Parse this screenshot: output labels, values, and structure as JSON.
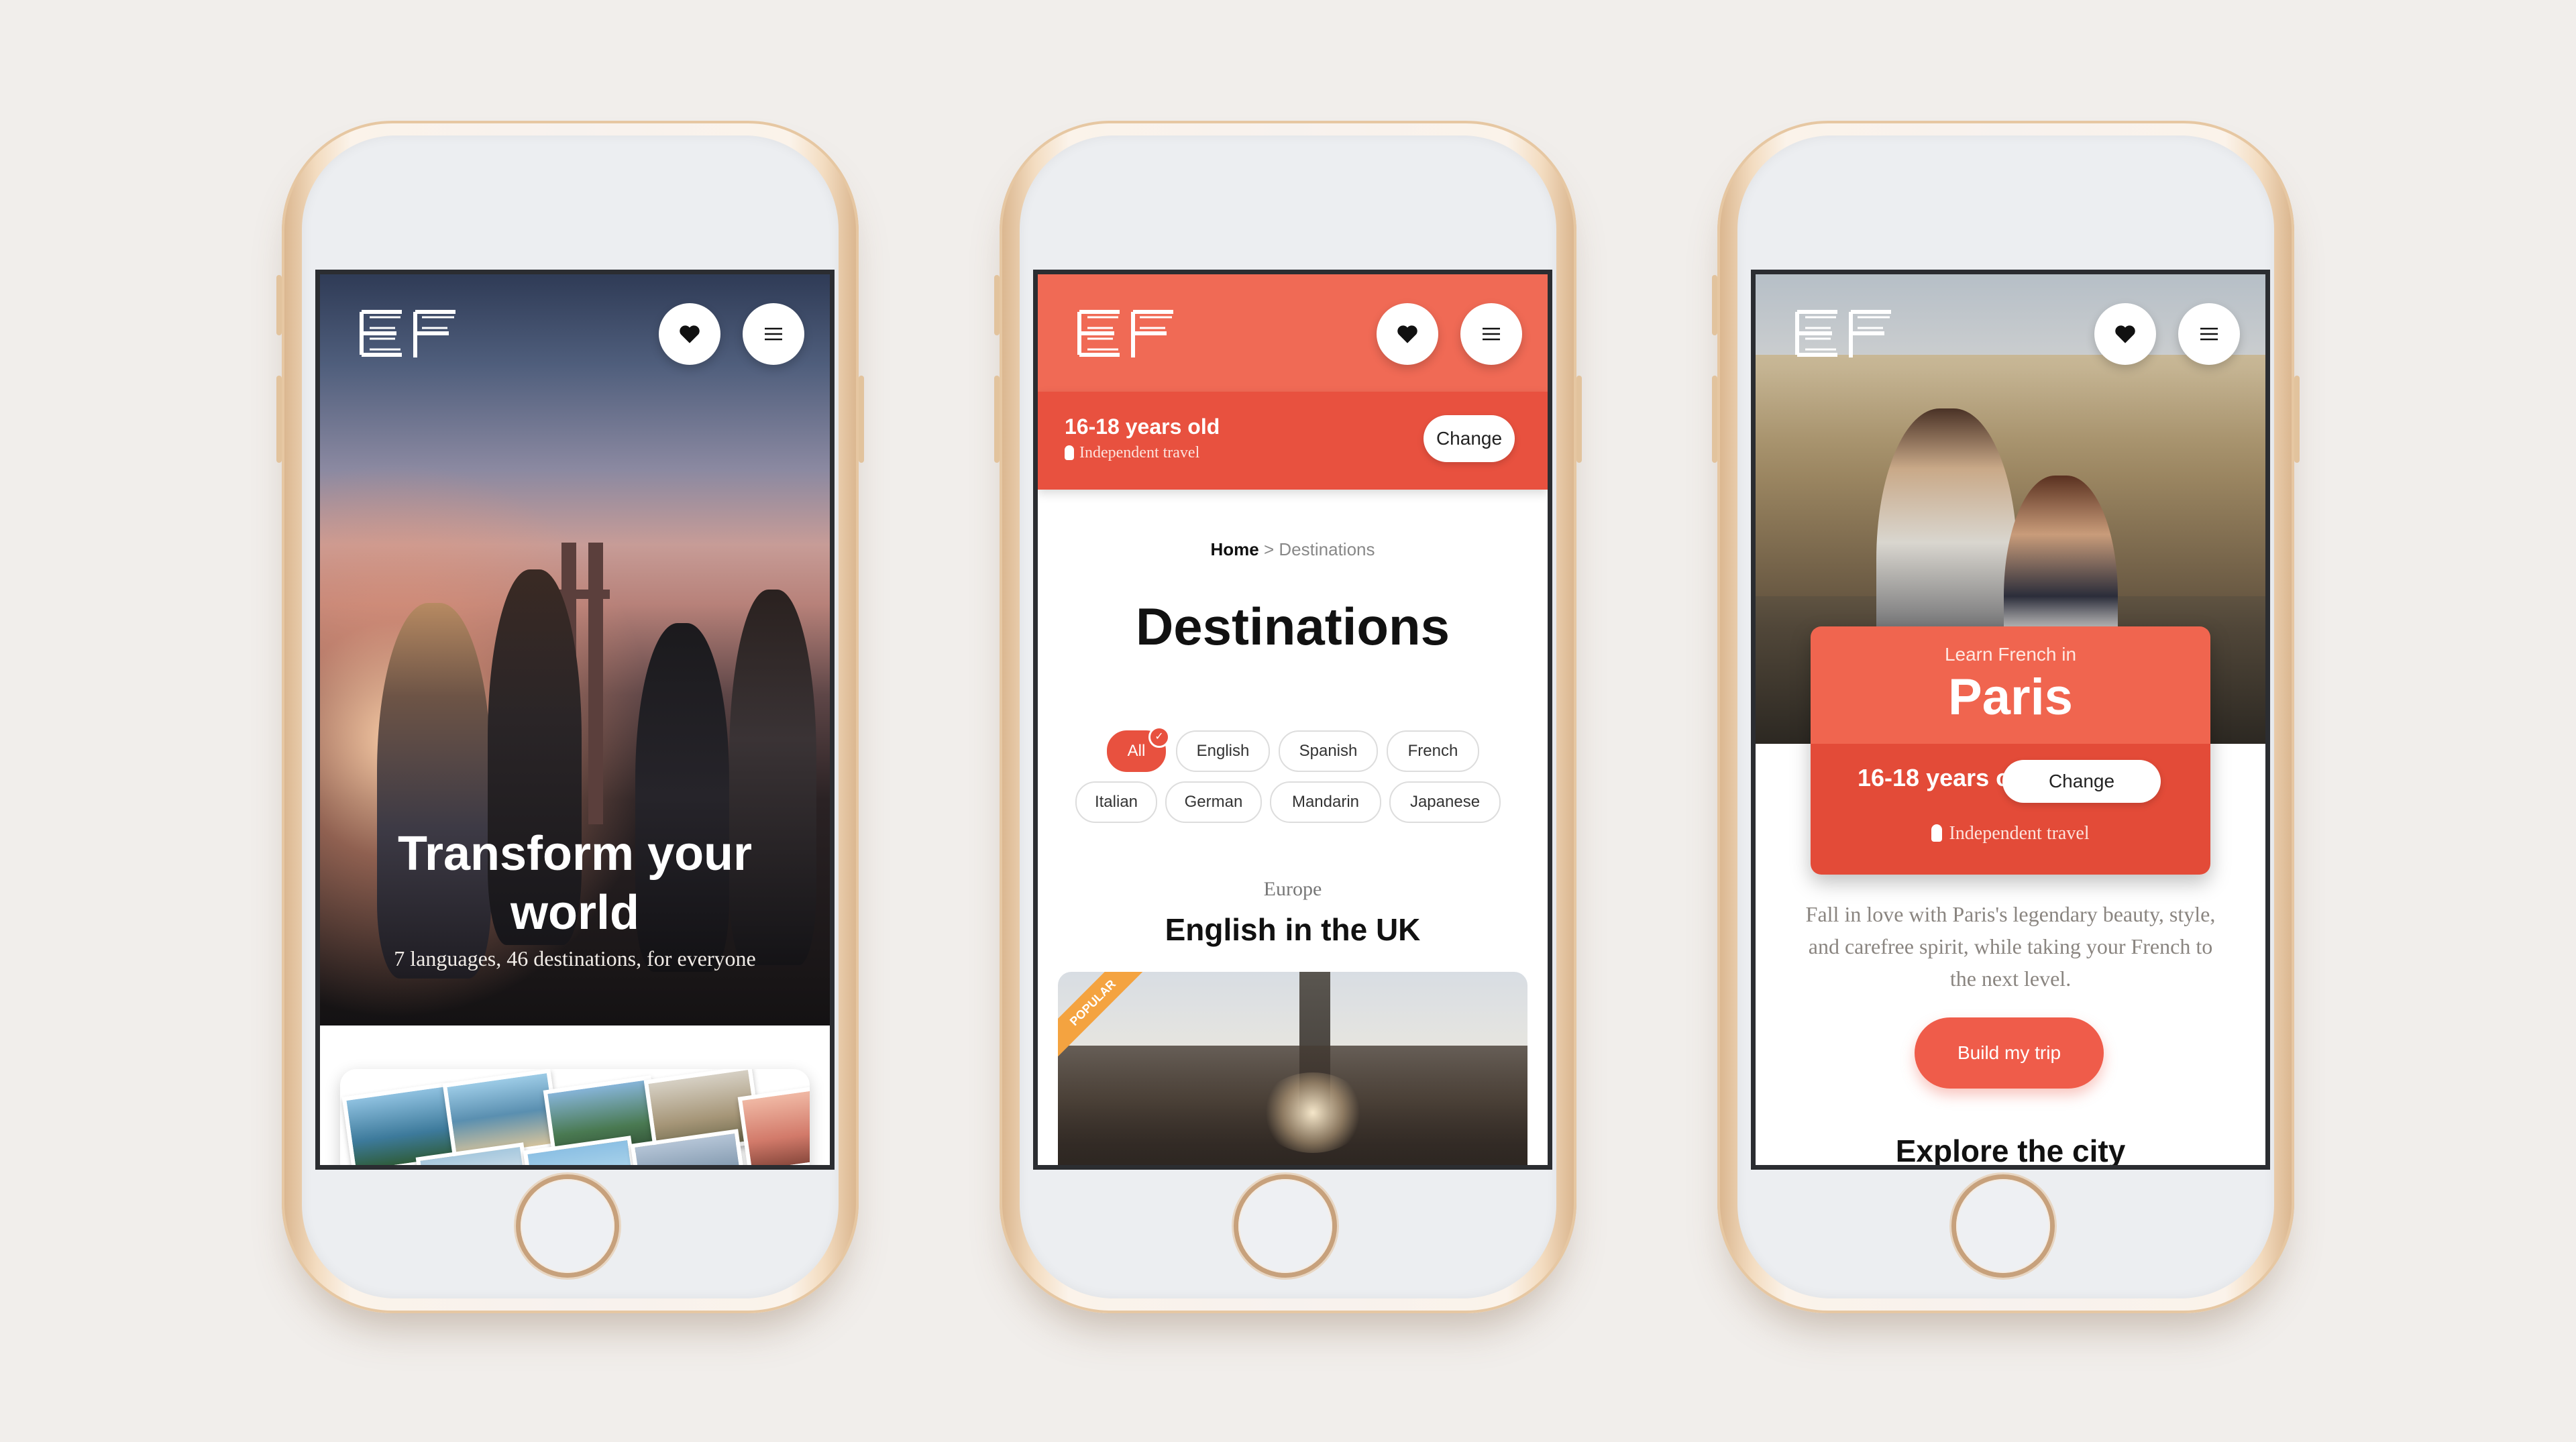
{
  "brand": {
    "logo_text": "EF",
    "accent": "#f06a55",
    "accent_dark": "#e8513f"
  },
  "phone1": {
    "hero_title": "Transform your\nworld",
    "hero_subtitle": "7 languages, 46 destinations, for everyone",
    "icons": [
      "heart-icon",
      "menu-icon"
    ]
  },
  "phone2": {
    "age": "16-18 years old",
    "travel_type": "Independent travel",
    "change_label": "Change",
    "breadcrumb": {
      "home": "Home",
      "separator": ">",
      "current": "Destinations"
    },
    "title": "Destinations",
    "filters": [
      "All",
      "English",
      "Spanish",
      "French",
      "Italian",
      "German",
      "Mandarin",
      "Japanese"
    ],
    "active_filter": "All",
    "region": "Europe",
    "destination": "English in the UK",
    "badge": "POPULAR"
  },
  "phone3": {
    "learn_label": "Learn French in",
    "city": "Paris",
    "age": "16-18 years old",
    "change_label": "Change",
    "travel_type": "Independent travel",
    "description": "Fall in love with Paris's legendary beauty, style, and carefree spirit, while taking your French to the next level.",
    "cta": "Build my trip",
    "section_title": "Explore the city"
  }
}
